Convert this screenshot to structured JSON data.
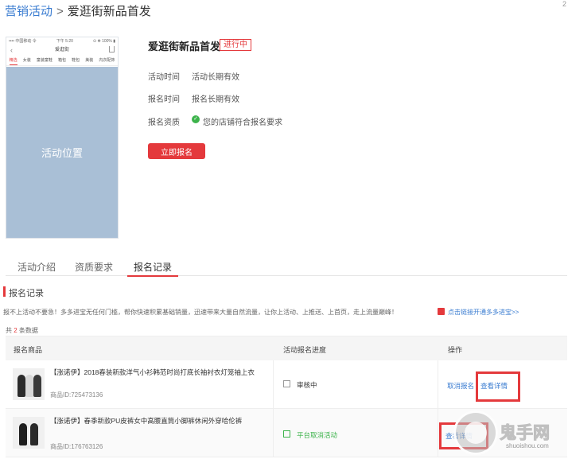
{
  "breadcrumb": {
    "parent": "营销活动",
    "separator": ">",
    "current": "爱逛街新品首发"
  },
  "corner_number": "2",
  "phone": {
    "status_left": "•••• 中国移动 令",
    "status_center": "下午 5:20",
    "status_right": "⊙ ✻ 100% ▮",
    "nav_title": "爱逛街",
    "tabs": [
      "精选",
      "女装",
      "童装童鞋",
      "箱包",
      "鞋包",
      "美装",
      "内衣配饰"
    ],
    "placement_label": "活动位置"
  },
  "activity": {
    "title": "爱逛街新品首发",
    "status_badge": "进行中",
    "activity_time_label": "活动时间",
    "activity_time_value": "活动长期有效",
    "signup_time_label": "报名时间",
    "signup_time_value": "报名长期有效",
    "qualification_label": "报名资质",
    "qualification_value": "您的店铺符合报名要求",
    "apply_button": "立即报名"
  },
  "tabs": [
    "活动介绍",
    "资质要求",
    "报名记录"
  ],
  "active_tab": "报名记录",
  "section_title": "报名记录",
  "notice": "报不上活动不要急！多多进宝无任何门槛，帮你快速积累基础销量，迅速带来大量自然流量，让你上活动、上推送、上首页，走上流量巅峰！",
  "promo_link": "点击链接开通多多进宝>>",
  "record_count": {
    "prefix": "共",
    "number": "2",
    "suffix": "条数据"
  },
  "table": {
    "headers": [
      "报名商品",
      "活动报名进度",
      "操作"
    ],
    "rows": [
      {
        "name": "【涨诺伊】2018春装新款洋气小衫韩范时尚打底长袖衬衣灯笼袖上衣",
        "id": "商品ID:725473136",
        "status": "审核中",
        "actions": [
          "取消报名",
          "查看详情"
        ]
      },
      {
        "name": "【涨诺伊】春季新款PU皮裤女中高腰直筒小脚裤休闲外穿哈伦裤",
        "id": "商品ID:176763126",
        "status": "平台取消活动",
        "actions": [
          "查看详情"
        ]
      }
    ]
  },
  "colors": {
    "accent": "#e4393c",
    "link": "#3a7cd1",
    "success": "#3cb34b",
    "placeholder": "#a9bfd6"
  },
  "watermark": {
    "text": "鬼手网",
    "url": "shuoishou.com"
  }
}
